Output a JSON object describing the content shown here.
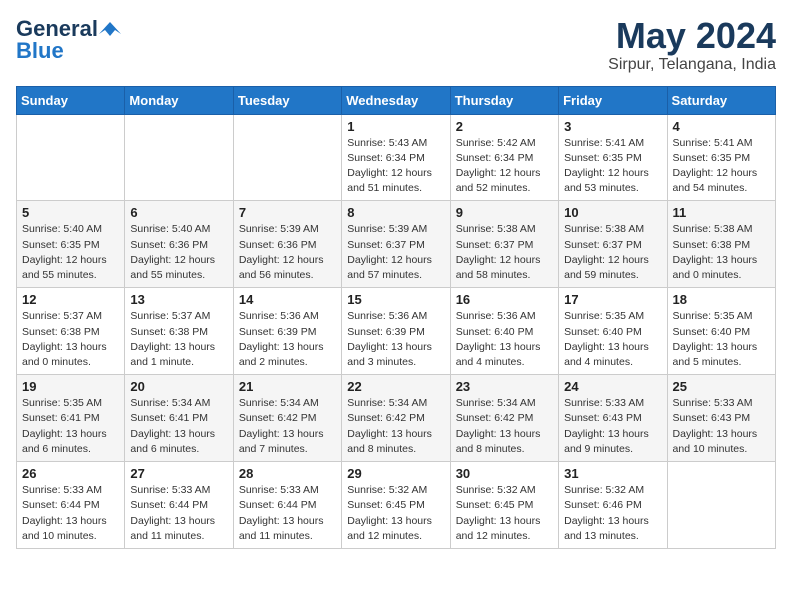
{
  "logo": {
    "general": "General",
    "blue": "Blue"
  },
  "header": {
    "month": "May 2024",
    "location": "Sirpur, Telangana, India"
  },
  "weekdays": [
    "Sunday",
    "Monday",
    "Tuesday",
    "Wednesday",
    "Thursday",
    "Friday",
    "Saturday"
  ],
  "weeks": [
    [
      {
        "day": "",
        "info": ""
      },
      {
        "day": "",
        "info": ""
      },
      {
        "day": "",
        "info": ""
      },
      {
        "day": "1",
        "info": "Sunrise: 5:43 AM\nSunset: 6:34 PM\nDaylight: 12 hours and 51 minutes."
      },
      {
        "day": "2",
        "info": "Sunrise: 5:42 AM\nSunset: 6:34 PM\nDaylight: 12 hours and 52 minutes."
      },
      {
        "day": "3",
        "info": "Sunrise: 5:41 AM\nSunset: 6:35 PM\nDaylight: 12 hours and 53 minutes."
      },
      {
        "day": "4",
        "info": "Sunrise: 5:41 AM\nSunset: 6:35 PM\nDaylight: 12 hours and 54 minutes."
      }
    ],
    [
      {
        "day": "5",
        "info": "Sunrise: 5:40 AM\nSunset: 6:35 PM\nDaylight: 12 hours and 55 minutes."
      },
      {
        "day": "6",
        "info": "Sunrise: 5:40 AM\nSunset: 6:36 PM\nDaylight: 12 hours and 55 minutes."
      },
      {
        "day": "7",
        "info": "Sunrise: 5:39 AM\nSunset: 6:36 PM\nDaylight: 12 hours and 56 minutes."
      },
      {
        "day": "8",
        "info": "Sunrise: 5:39 AM\nSunset: 6:37 PM\nDaylight: 12 hours and 57 minutes."
      },
      {
        "day": "9",
        "info": "Sunrise: 5:38 AM\nSunset: 6:37 PM\nDaylight: 12 hours and 58 minutes."
      },
      {
        "day": "10",
        "info": "Sunrise: 5:38 AM\nSunset: 6:37 PM\nDaylight: 12 hours and 59 minutes."
      },
      {
        "day": "11",
        "info": "Sunrise: 5:38 AM\nSunset: 6:38 PM\nDaylight: 13 hours and 0 minutes."
      }
    ],
    [
      {
        "day": "12",
        "info": "Sunrise: 5:37 AM\nSunset: 6:38 PM\nDaylight: 13 hours and 0 minutes."
      },
      {
        "day": "13",
        "info": "Sunrise: 5:37 AM\nSunset: 6:38 PM\nDaylight: 13 hours and 1 minute."
      },
      {
        "day": "14",
        "info": "Sunrise: 5:36 AM\nSunset: 6:39 PM\nDaylight: 13 hours and 2 minutes."
      },
      {
        "day": "15",
        "info": "Sunrise: 5:36 AM\nSunset: 6:39 PM\nDaylight: 13 hours and 3 minutes."
      },
      {
        "day": "16",
        "info": "Sunrise: 5:36 AM\nSunset: 6:40 PM\nDaylight: 13 hours and 4 minutes."
      },
      {
        "day": "17",
        "info": "Sunrise: 5:35 AM\nSunset: 6:40 PM\nDaylight: 13 hours and 4 minutes."
      },
      {
        "day": "18",
        "info": "Sunrise: 5:35 AM\nSunset: 6:40 PM\nDaylight: 13 hours and 5 minutes."
      }
    ],
    [
      {
        "day": "19",
        "info": "Sunrise: 5:35 AM\nSunset: 6:41 PM\nDaylight: 13 hours and 6 minutes."
      },
      {
        "day": "20",
        "info": "Sunrise: 5:34 AM\nSunset: 6:41 PM\nDaylight: 13 hours and 6 minutes."
      },
      {
        "day": "21",
        "info": "Sunrise: 5:34 AM\nSunset: 6:42 PM\nDaylight: 13 hours and 7 minutes."
      },
      {
        "day": "22",
        "info": "Sunrise: 5:34 AM\nSunset: 6:42 PM\nDaylight: 13 hours and 8 minutes."
      },
      {
        "day": "23",
        "info": "Sunrise: 5:34 AM\nSunset: 6:42 PM\nDaylight: 13 hours and 8 minutes."
      },
      {
        "day": "24",
        "info": "Sunrise: 5:33 AM\nSunset: 6:43 PM\nDaylight: 13 hours and 9 minutes."
      },
      {
        "day": "25",
        "info": "Sunrise: 5:33 AM\nSunset: 6:43 PM\nDaylight: 13 hours and 10 minutes."
      }
    ],
    [
      {
        "day": "26",
        "info": "Sunrise: 5:33 AM\nSunset: 6:44 PM\nDaylight: 13 hours and 10 minutes."
      },
      {
        "day": "27",
        "info": "Sunrise: 5:33 AM\nSunset: 6:44 PM\nDaylight: 13 hours and 11 minutes."
      },
      {
        "day": "28",
        "info": "Sunrise: 5:33 AM\nSunset: 6:44 PM\nDaylight: 13 hours and 11 minutes."
      },
      {
        "day": "29",
        "info": "Sunrise: 5:32 AM\nSunset: 6:45 PM\nDaylight: 13 hours and 12 minutes."
      },
      {
        "day": "30",
        "info": "Sunrise: 5:32 AM\nSunset: 6:45 PM\nDaylight: 13 hours and 12 minutes."
      },
      {
        "day": "31",
        "info": "Sunrise: 5:32 AM\nSunset: 6:46 PM\nDaylight: 13 hours and 13 minutes."
      },
      {
        "day": "",
        "info": ""
      }
    ]
  ]
}
